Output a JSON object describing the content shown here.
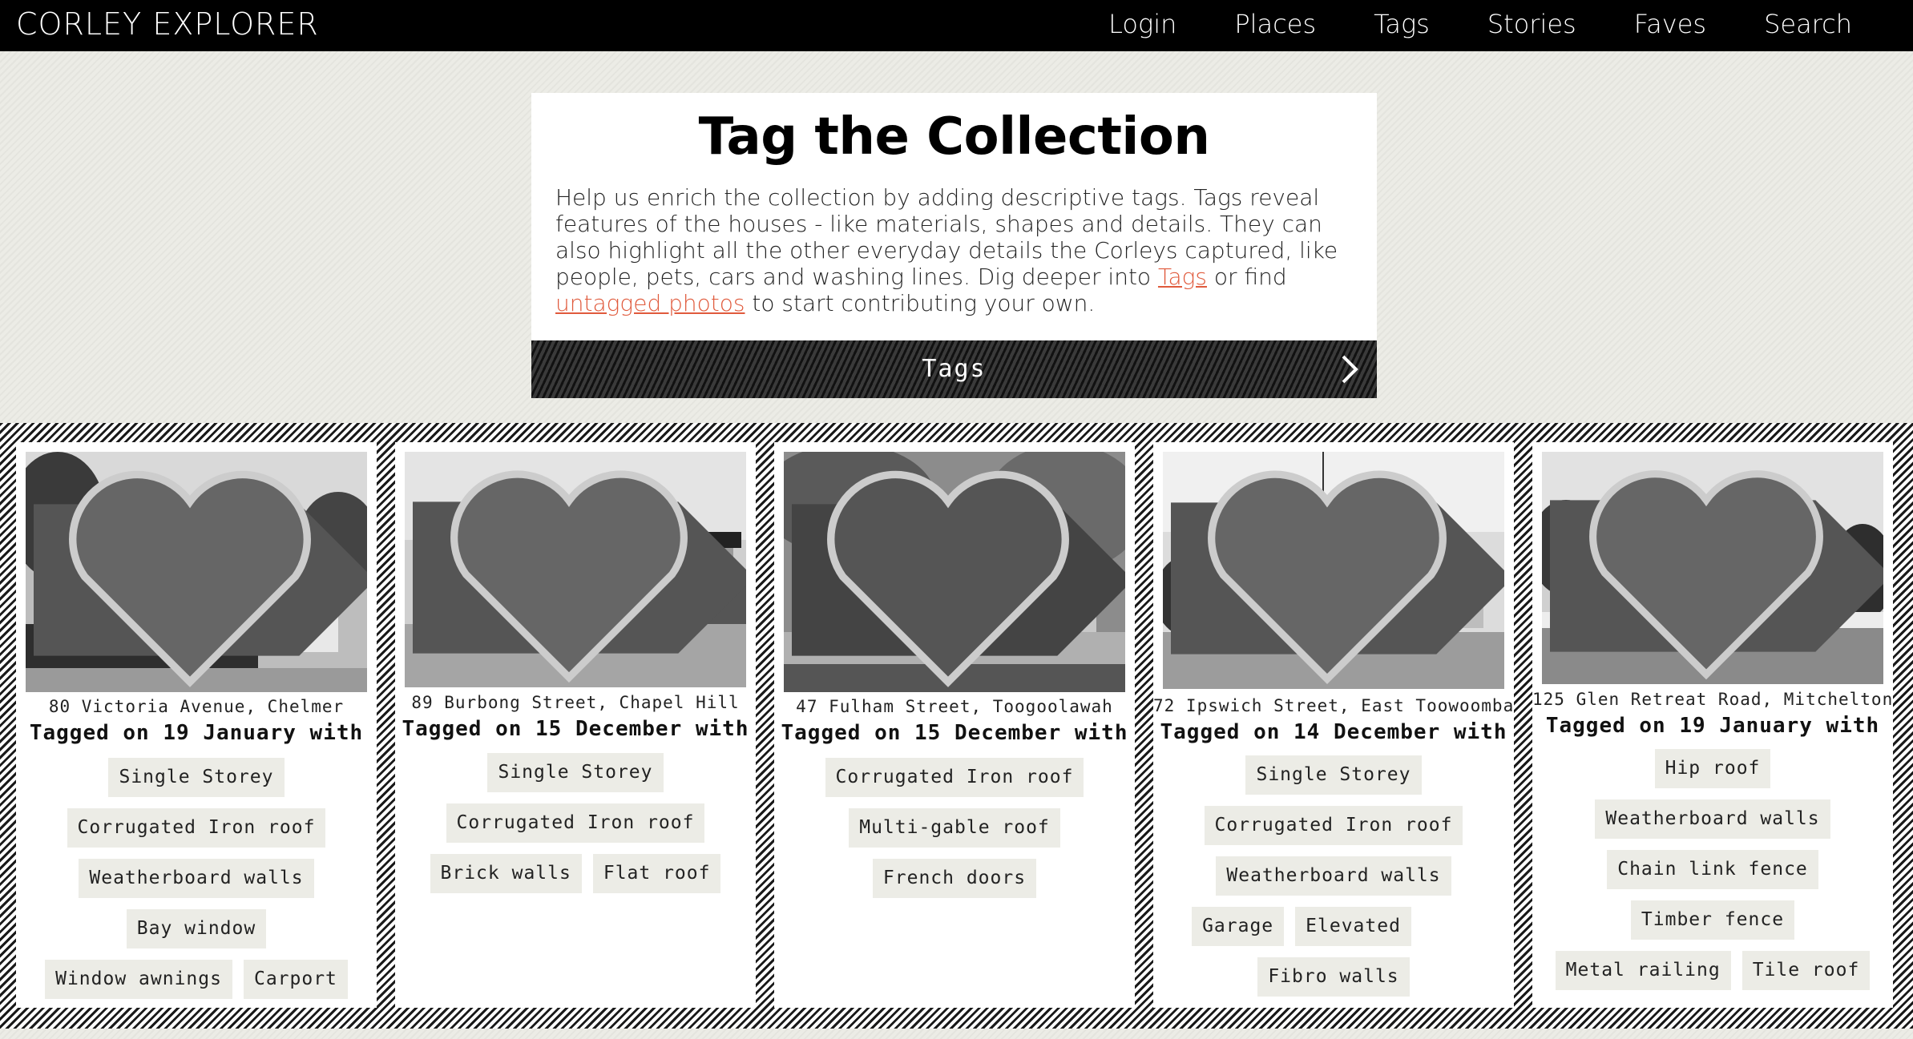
{
  "brand": "CORLEY EXPLORER",
  "nav": [
    "Login",
    "Places",
    "Tags",
    "Stories",
    "Faves",
    "Search"
  ],
  "intro": {
    "title": "Tag the Collection",
    "body_1": "Help us enrich the collection by adding descriptive tags. Tags reveal features of the houses - like materials, shapes and details. They can also highlight all the other everyday details the Corleys captured, like people, pets, cars and washing lines. Dig deeper into ",
    "link_tags": "Tags",
    "body_2": " or find ",
    "link_untagged": "untagged photos",
    "body_3": " to start contributing your own.",
    "button_label": "Tags"
  },
  "cards": [
    {
      "address": "80 Victoria Avenue, Chelmer",
      "tagged_line": "Tagged on 19 January with",
      "tags": [
        "Single Storey",
        "Corrugated Iron roof",
        "Weatherboard walls",
        "Bay window",
        "Window awnings",
        "Carport"
      ]
    },
    {
      "address": "89 Burbong Street, Chapel Hill",
      "tagged_line": "Tagged on 15 December with",
      "tags": [
        "Single Storey",
        "Corrugated Iron roof",
        "Brick walls",
        "Flat roof"
      ]
    },
    {
      "address": "47 Fulham Street, Toogoolawah",
      "tagged_line": "Tagged on 15 December with",
      "tags": [
        "Corrugated Iron roof",
        "Multi-gable roof",
        "French doors"
      ]
    },
    {
      "address": "72 Ipswich Street, East Toowoomba",
      "tagged_line": "Tagged on 14 December with",
      "tags": [
        "Single Storey",
        "Corrugated Iron roof",
        "Weatherboard walls",
        "Garage",
        "Elevated",
        "Fibro walls"
      ]
    },
    {
      "address": "125 Glen Retreat Road, Mitchelton",
      "tagged_line": "Tagged on 19 January with",
      "tags": [
        "Hip roof",
        "Weatherboard walls",
        "Chain link fence",
        "Timber fence",
        "Metal railing",
        "Tile roof"
      ]
    }
  ],
  "colors": {
    "link": "#e05a3c",
    "topbar": "#000000",
    "chip_bg": "#ececE6"
  }
}
